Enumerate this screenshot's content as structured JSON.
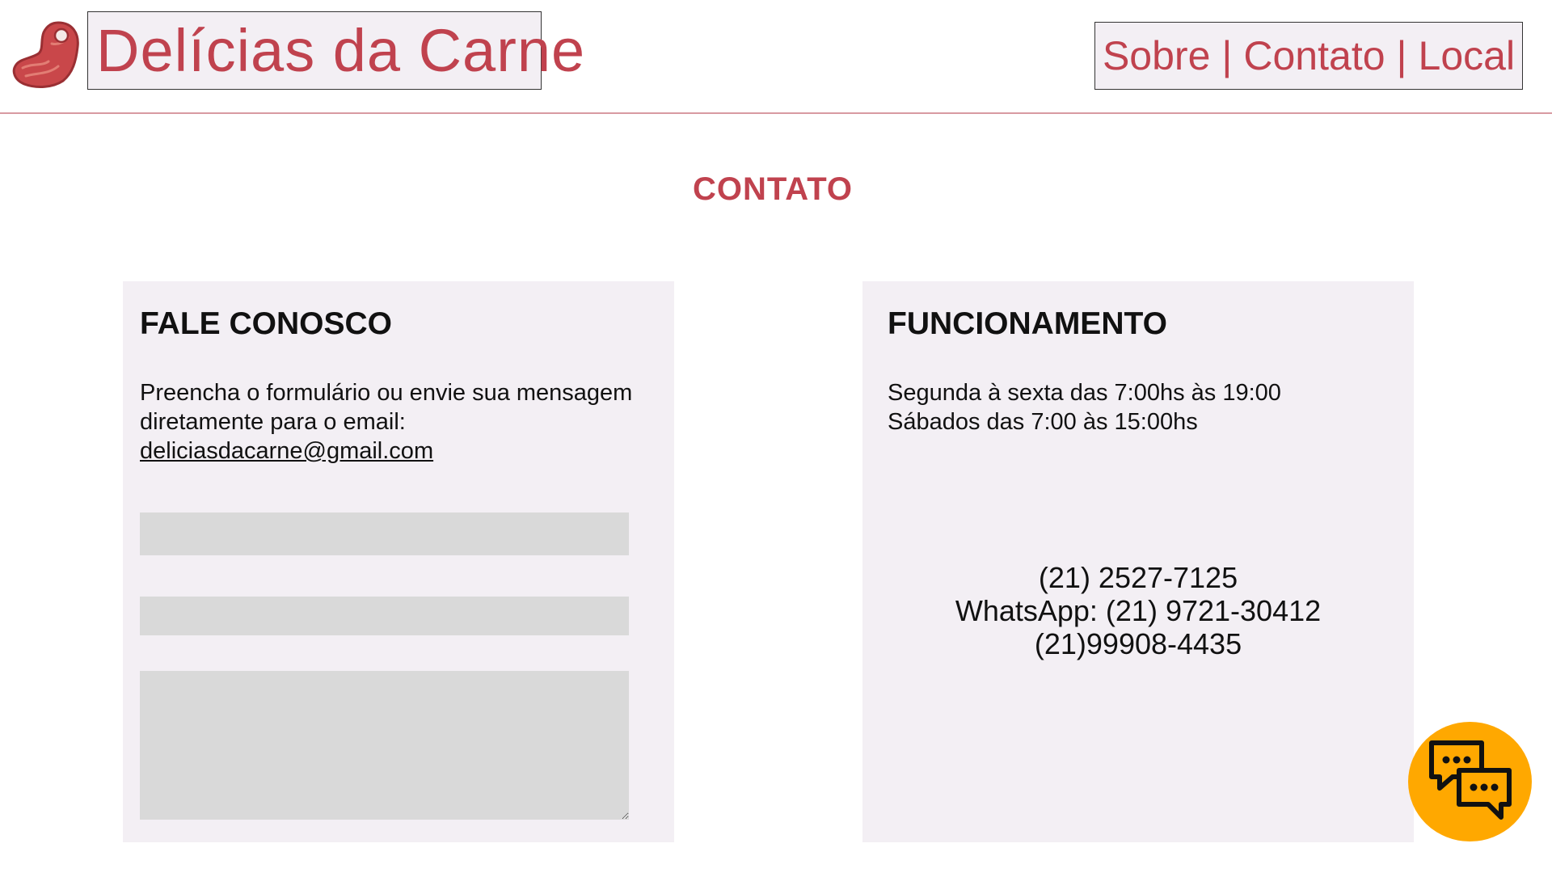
{
  "header": {
    "logo_icon": "meat-steak-icon",
    "brand": "Delícias da Carne",
    "nav": [
      "Sobre",
      "Contato",
      "Local"
    ],
    "separator": "|"
  },
  "page": {
    "title": "CONTATO"
  },
  "contact_card": {
    "heading": "FALE CONOSCO",
    "text": "Preencha o formulário ou envie sua mensagem diretamente para o email:",
    "email": "deliciasdacarne@gmail.com"
  },
  "hours_card": {
    "heading": "FUNCIONAMENTO",
    "weekdays": "Segunda à sexta das 7:00hs às 19:00",
    "saturday": "Sábados das 7:00 às 15:00hs",
    "phones": [
      "(21) 2527-7125",
      "WhatsApp: (21) 9721-30412",
      "(21)99908-4435"
    ]
  },
  "chat_button": {
    "icon": "chat-bubbles-icon"
  },
  "colors": {
    "brand_red": "#c0424e",
    "card_bg": "#f3eff4",
    "input_bg": "#d9d9d9",
    "chat_orange": "#ffa800",
    "divider": "#d89aa1"
  }
}
